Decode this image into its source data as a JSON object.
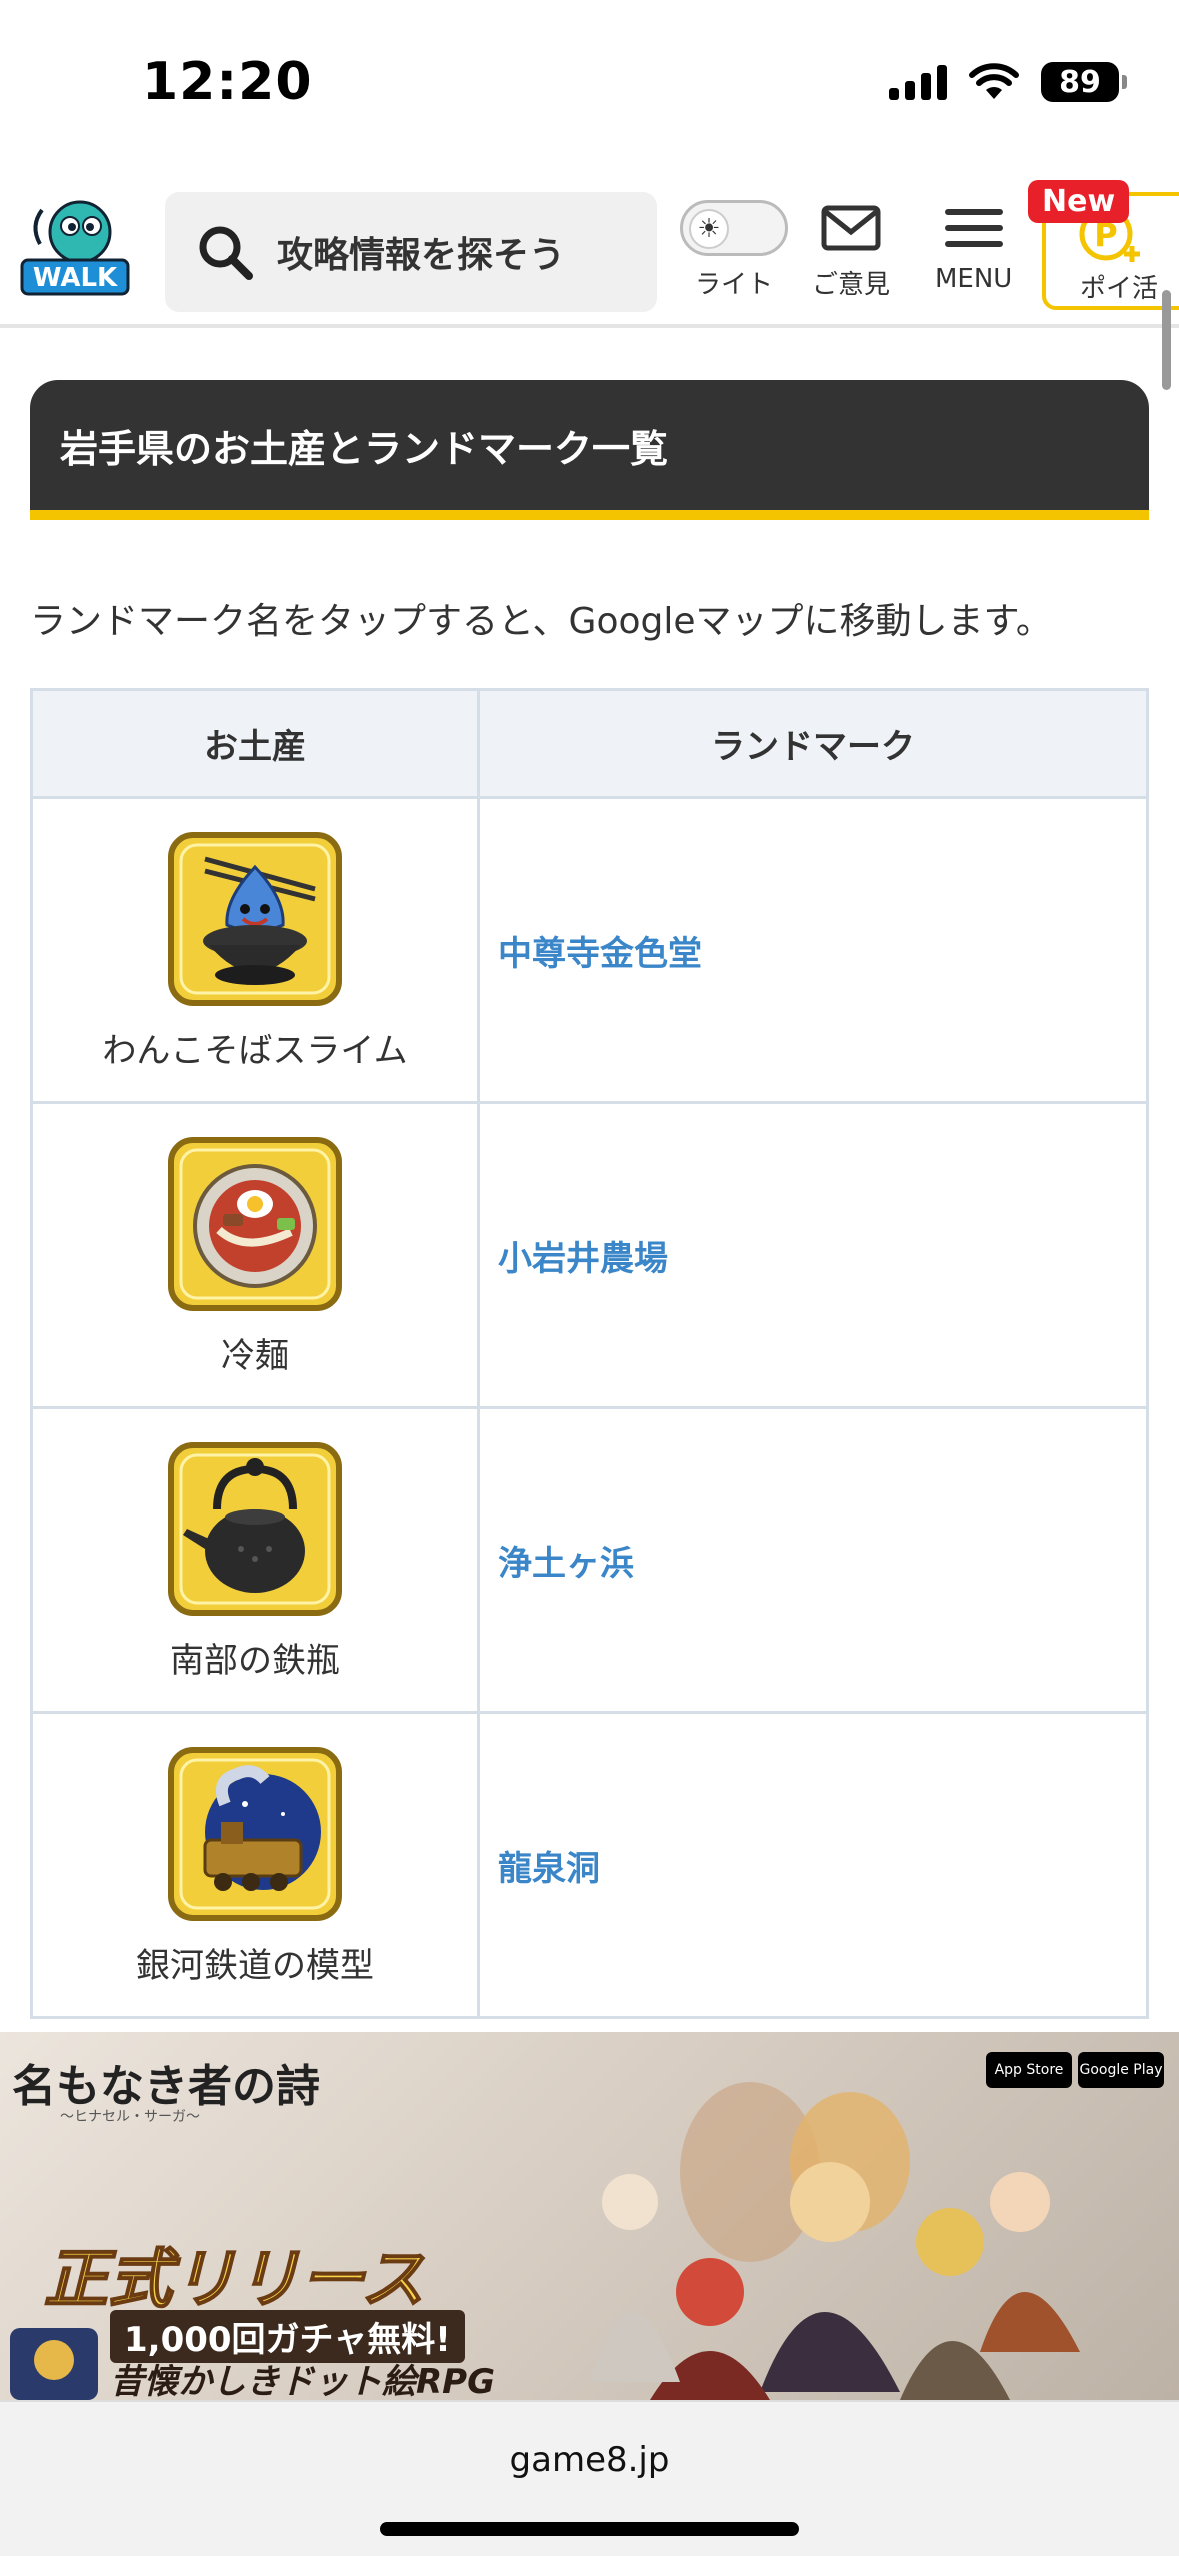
{
  "status_bar": {
    "time": "12:20",
    "battery": "89"
  },
  "header": {
    "logo_text": "WALK",
    "search_placeholder": "攻略情報を探そう",
    "theme_label": "ライト",
    "feedback_label": "ご意見",
    "menu_label": "MENU",
    "poi_label": "ポイ活",
    "new_badge": "New",
    "accent_color": "#f5c400"
  },
  "article": {
    "heading": "岩手県のお土産とランドマーク一覧",
    "intro": "ランドマーク名をタップすると、Googleマップに移動します。",
    "table": {
      "headers": [
        "お土産",
        "ランドマーク"
      ],
      "rows": [
        {
          "item": "わんこそばスライム",
          "icon": "wanko-soba-slime-icon",
          "landmark": "中尊寺金色堂"
        },
        {
          "item": "冷麺",
          "icon": "reimen-icon",
          "landmark": "小岩井農場"
        },
        {
          "item": "南部の鉄瓶",
          "icon": "iron-kettle-icon",
          "landmark": "浄土ヶ浜"
        },
        {
          "item": "銀河鉄道の模型",
          "icon": "galaxy-train-icon",
          "landmark": "龍泉洞"
        }
      ]
    }
  },
  "ad": {
    "title": "名もなき者の詩",
    "subtitle": "〜ヒナセル・サーガ〜",
    "release": "正式リリース",
    "line1": "1,000回ガチャ無料!",
    "line2": "昔懐かしきドット絵RPG",
    "store1": "App Store",
    "store2": "Google Play"
  },
  "browser": {
    "url": "game8.jp"
  }
}
